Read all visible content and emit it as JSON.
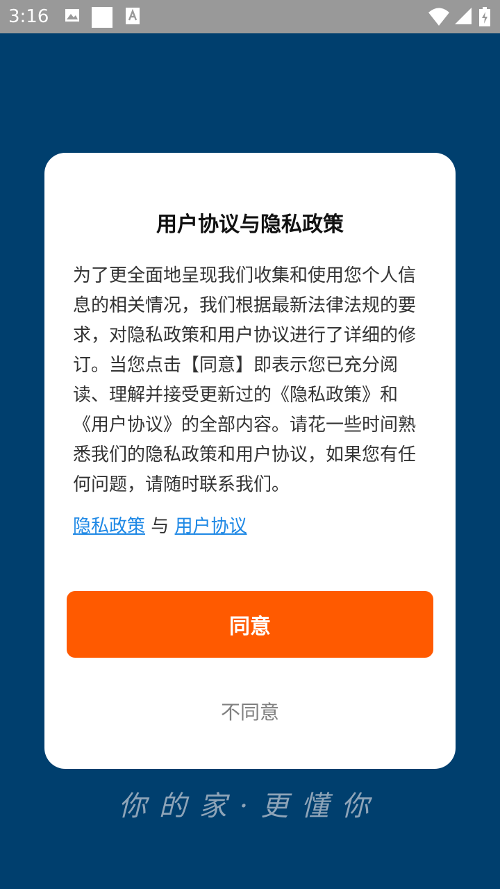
{
  "status_bar": {
    "time": "3:16",
    "icons": [
      "image-icon",
      "square-icon",
      "font-icon",
      "wifi-icon",
      "signal-icon",
      "battery-icon"
    ]
  },
  "dialog": {
    "title": "用户协议与隐私政策",
    "body": "为了更全面地呈现我们收集和使用您个人信息的相关情况，我们根据最新法律法规的要求，对隐私政策和用户协议进行了详细的修订。当您点击【同意】即表示您已充分阅读、理解并接受更新过的《隐私政策》和《用户协议》的全部内容。请花一些时间熟悉我们的隐私政策和用户协议，如果您有任何问题，请随时联系我们。",
    "privacy_link": "隐私政策",
    "link_separator": "与",
    "terms_link": "用户协议",
    "agree_label": "同意",
    "disagree_label": "不同意"
  },
  "slogan": "你的家·更懂你",
  "colors": {
    "background": "#003f6e",
    "status_bar": "#999999",
    "agree_button": "#ff5a00",
    "link": "#1e88e5"
  }
}
